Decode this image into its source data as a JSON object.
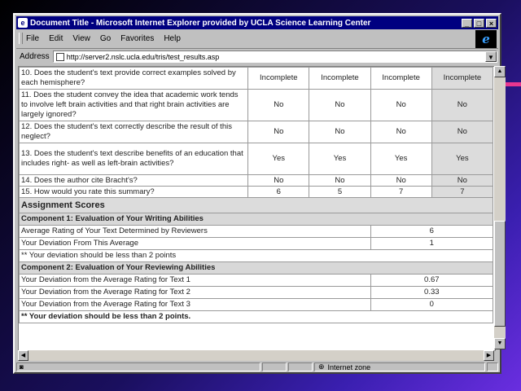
{
  "window": {
    "title": "Document Title - Microsoft Internet Explorer provided by UCLA Science Learning Center",
    "controls": {
      "minimize": "_",
      "maximize": "□",
      "close": "×"
    }
  },
  "menu": [
    "File",
    "Edit",
    "View",
    "Go",
    "Favorites",
    "Help"
  ],
  "address": {
    "label": "Address",
    "url": "http://server2.nslc.ucla.edu/tris/test_results.asp"
  },
  "questions": [
    {
      "text": "10. Does the student's text provide correct examples solved by each hemisphere?",
      "answers": [
        "Incomplete",
        "Incomplete",
        "Incomplete",
        "Incomplete"
      ]
    },
    {
      "text": "11. Does the student convey the idea that academic work tends to involve left brain activities and that right brain activities are largely ignored?",
      "answers": [
        "No",
        "No",
        "No",
        "No"
      ]
    },
    {
      "text": "12. Does the student's text correctly describe the result of this neglect?",
      "answers": [
        "No",
        "No",
        "No",
        "No"
      ]
    },
    {
      "text": "13. Does the student's text describe benefits of an education that includes right- as well as left-brain activities?",
      "answers": [
        "Yes",
        "Yes",
        "Yes",
        "Yes"
      ]
    },
    {
      "text": "14. Does the author cite Bracht's?",
      "answers": [
        "No",
        "No",
        "No",
        "No"
      ]
    },
    {
      "text": "15. How would you rate this summary?",
      "answers": [
        "6",
        "5",
        "7",
        "7"
      ]
    }
  ],
  "assignment": {
    "heading": "Assignment Scores",
    "component1": {
      "heading": "Component 1: Evaluation of Your Writing Abilities",
      "rows": [
        {
          "label": "Average Rating of Your Text Determined by Reviewers",
          "value": "6"
        },
        {
          "label": "Your Deviation From This Average",
          "value": "1"
        }
      ],
      "note": "** Your deviation should be less than 2 points"
    },
    "component2": {
      "heading": "Component 2: Evaluation of Your Reviewing Abilities",
      "rows": [
        {
          "label": "Your Deviation from the Average Rating for Text 1",
          "value": "0.67"
        },
        {
          "label": "Your Deviation from the Average Rating for Text 2",
          "value": "0.33"
        },
        {
          "label": "Your Deviation from the Average Rating for Text 3",
          "value": "0"
        }
      ],
      "note": "** Your deviation should be less than 2 points."
    }
  },
  "status": {
    "zone": "Internet zone"
  },
  "colors": {
    "titlebar": "#000080",
    "accent": "#e8368f"
  }
}
